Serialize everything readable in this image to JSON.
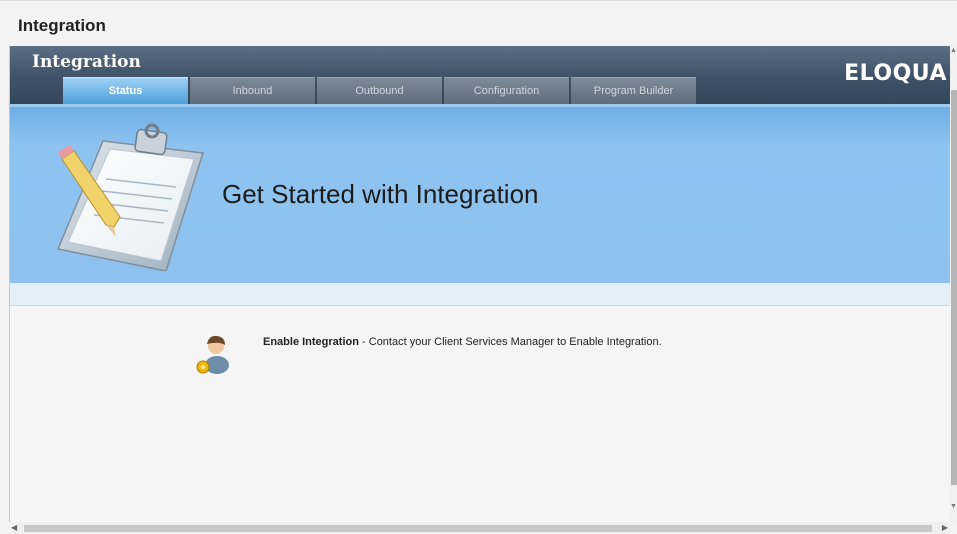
{
  "page": {
    "title": "Integration"
  },
  "header": {
    "app_title": "Integration",
    "brand": "ELOQUA"
  },
  "tabs": [
    {
      "label": "Status",
      "active": true
    },
    {
      "label": "Inbound",
      "active": false
    },
    {
      "label": "Outbound",
      "active": false
    },
    {
      "label": "Configuration",
      "active": false
    },
    {
      "label": "Program Builder",
      "active": false
    }
  ],
  "hero": {
    "heading": "Get Started with Integration",
    "icon": "clipboard-pencil-icon"
  },
  "notice": {
    "icon": "user-settings-icon",
    "title": "Enable Integration",
    "separator": " - ",
    "message": "Contact your Client Services Manager to Enable Integration."
  },
  "colors": {
    "header": "#3e5166",
    "active_tab": "#4ea0dc",
    "hero": "#8ec3f0"
  }
}
